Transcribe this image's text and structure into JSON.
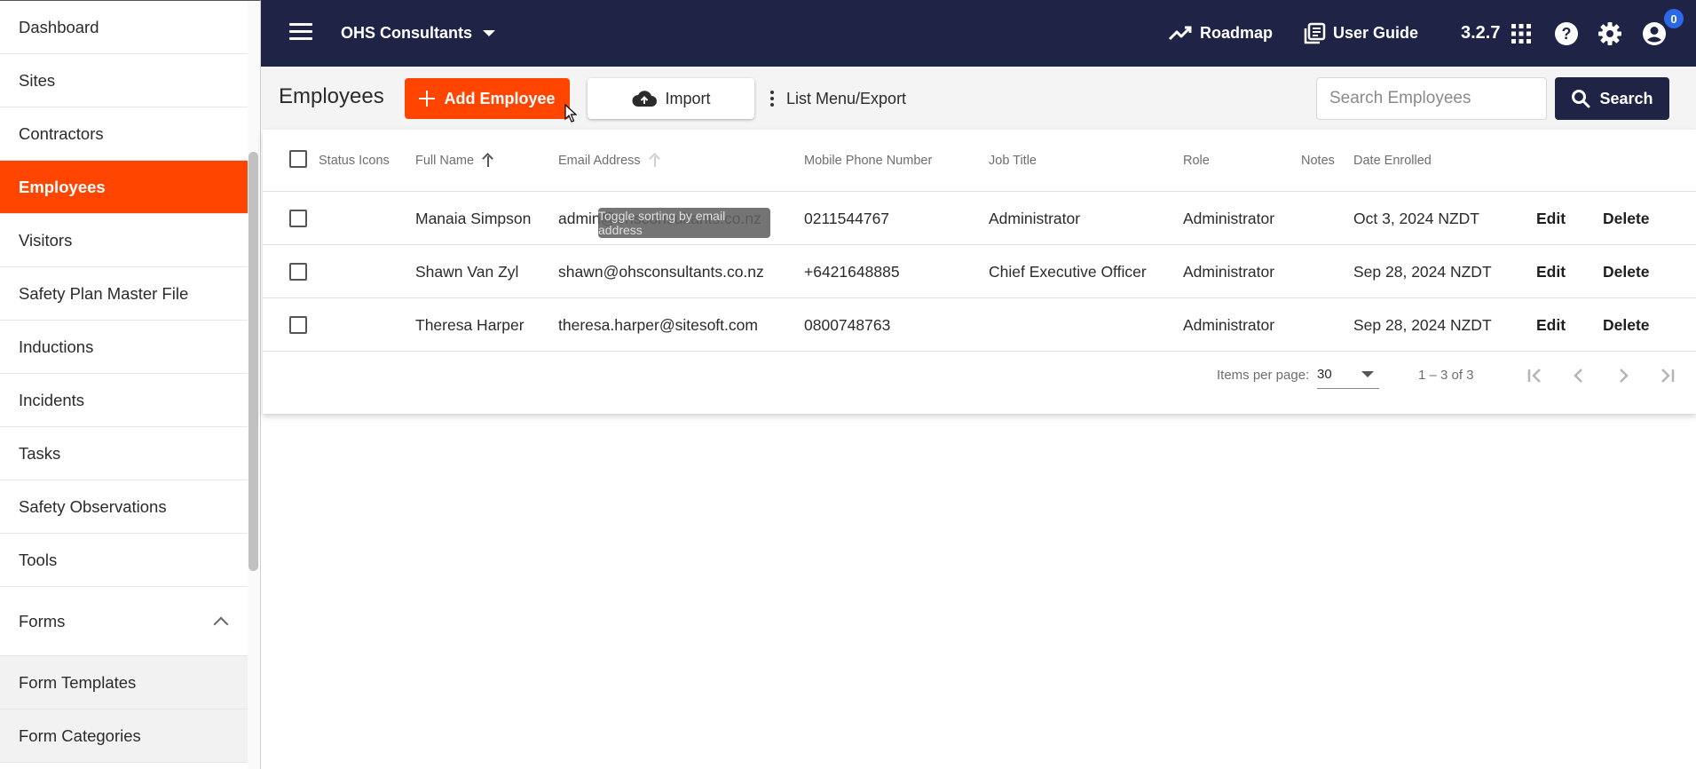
{
  "sidebar": {
    "items": [
      {
        "label": "Dashboard"
      },
      {
        "label": "Sites"
      },
      {
        "label": "Contractors"
      },
      {
        "label": "Employees"
      },
      {
        "label": "Visitors"
      },
      {
        "label": "Safety Plan Master File"
      },
      {
        "label": "Inductions"
      },
      {
        "label": "Incidents"
      },
      {
        "label": "Tasks"
      },
      {
        "label": "Safety Observations"
      },
      {
        "label": "Tools"
      }
    ],
    "group": {
      "label": "Forms"
    },
    "sub_items": [
      {
        "label": "Form Templates"
      },
      {
        "label": "Form Categories"
      }
    ]
  },
  "topbar": {
    "org_name": "OHS Consultants",
    "roadmap": "Roadmap",
    "user_guide": "User Guide",
    "version": "3.2.7",
    "notification_count": "0"
  },
  "page": {
    "title": "Employees",
    "add_label": "Add Employee",
    "import_label": "Import",
    "list_menu_label": "List Menu/Export",
    "search_placeholder": "Search Employees",
    "search_label": "Search"
  },
  "table": {
    "headers": {
      "status_icons": "Status Icons",
      "full_name": "Full Name",
      "email": "Email Address",
      "mobile": "Mobile Phone Number",
      "job_title": "Job Title",
      "role": "Role",
      "notes": "Notes",
      "date_enrolled": "Date Enrolled"
    },
    "rows": [
      {
        "full_name": "Manaia Simpson",
        "email": "admin@ohsconsultants.co.nz",
        "mobile": "0211544767",
        "job_title": "Administrator",
        "role": "Administrator",
        "date_enrolled": "Oct 3, 2024 NZDT",
        "edit": "Edit",
        "delete": "Delete"
      },
      {
        "full_name": "Shawn Van Zyl",
        "email": "shawn@ohsconsultants.co.nz",
        "mobile": "+6421648885",
        "job_title": "Chief Executive Officer",
        "role": "Administrator",
        "date_enrolled": "Sep 28, 2024 NZDT",
        "edit": "Edit",
        "delete": "Delete"
      },
      {
        "full_name": "Theresa Harper",
        "email": "theresa.harper@sitesoft.com",
        "mobile": "0800748763",
        "job_title": "",
        "role": "Administrator",
        "date_enrolled": "Sep 28, 2024 NZDT",
        "edit": "Edit",
        "delete": "Delete"
      }
    ],
    "tooltip": "Toggle sorting by email address"
  },
  "paginator": {
    "items_per_page_label": "Items per page:",
    "page_size": "30",
    "range": "1 – 3 of 3"
  },
  "colors": {
    "accent": "#ff4500",
    "navy": "#1f2346",
    "badge": "#2d68e8"
  }
}
